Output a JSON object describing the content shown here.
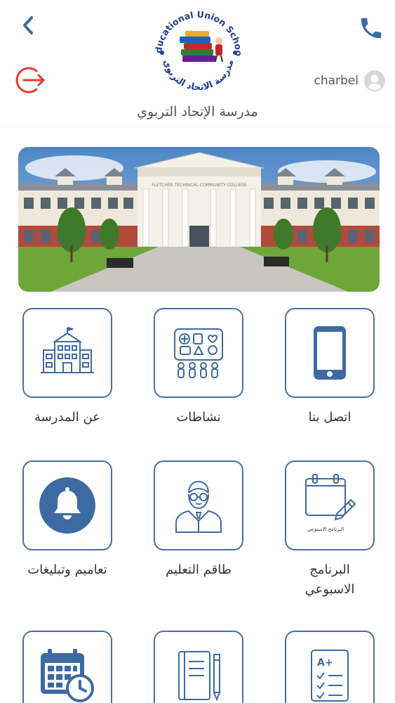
{
  "header": {
    "logo_top_text": "Educational Union School",
    "logo_bottom_text": "مدرسة الاتحاد التربوي",
    "user_name": "charbel",
    "school_name": "مدرسة الإتحاد التربوي"
  },
  "banner": {
    "building_sign": "FLETCHER TECHNICAL COMMUNITY COLLEGE"
  },
  "menu": [
    {
      "label": "عن المدرسة",
      "icon": "school-building-icon"
    },
    {
      "label": "نشاطات",
      "icon": "activities-board-icon"
    },
    {
      "label": "اتصل بنا",
      "icon": "mobile-phone-icon"
    },
    {
      "label": "تعاميم وتبليغات",
      "icon": "bell-icon"
    },
    {
      "label": "طاقم التعليم",
      "icon": "teacher-icon"
    },
    {
      "label": "البرنامج\nالاسبوعي",
      "label_line1": "البرنامج",
      "label_line2": "الاسبوعي",
      "icon": "weekly-schedule-icon",
      "icon_caption": "البرنامج الاسبوعي"
    },
    {
      "label": "",
      "icon": "calendar-icon"
    },
    {
      "label": "",
      "icon": "notebook-pencil-icon"
    },
    {
      "label": "",
      "icon": "grades-checklist-icon",
      "icon_caption": "A+"
    }
  ],
  "colors": {
    "accent": "#4a6fa5",
    "icon_blue": "#3d6aa3",
    "logout_red": "#e53935",
    "tile_border": "#4a6fa5"
  }
}
